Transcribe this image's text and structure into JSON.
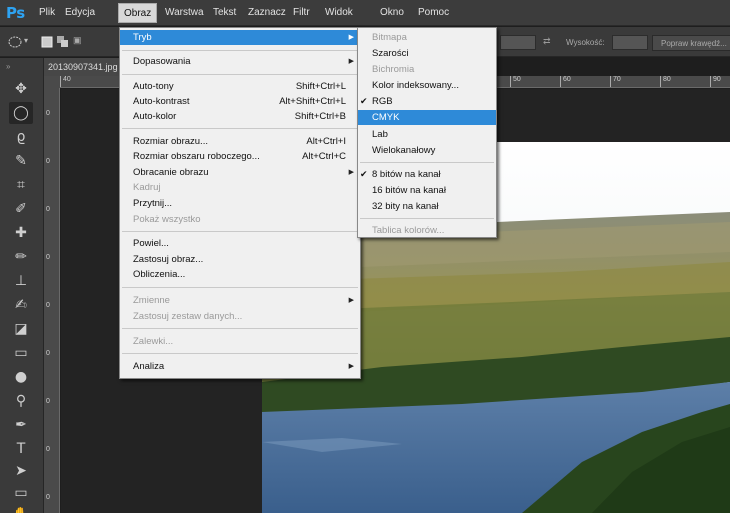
{
  "app": {
    "logo": "Ps"
  },
  "menubar": {
    "items": [
      "Plik",
      "Edycja",
      "Obraz",
      "Warstwa",
      "Tekst",
      "Zaznacz",
      "Filtr",
      "Widok",
      "Okno",
      "Pomoc"
    ],
    "active": "Obraz"
  },
  "options_bar": {
    "height_label": "Wysokość:",
    "refine_button": "Popraw krawędź..."
  },
  "document": {
    "tab_title": "20130907341.jpg",
    "ruler_top": [
      "40",
      "50",
      "60",
      "70",
      "80",
      "90"
    ],
    "ruler_left": [
      "0",
      "0",
      "0",
      "0",
      "0",
      "0",
      "0",
      "0",
      "0",
      "0",
      "0",
      "0",
      "0",
      "0",
      "0"
    ]
  },
  "obraz_menu": {
    "items": [
      {
        "label": "Tryb",
        "shortcut": "",
        "submenu": true,
        "highlighted": true,
        "disabled": false
      },
      {
        "label": "Dopasowania",
        "shortcut": "",
        "submenu": true,
        "highlighted": false,
        "disabled": false
      },
      {
        "label": "Auto-tony",
        "shortcut": "Shift+Ctrl+L",
        "submenu": false,
        "highlighted": false,
        "disabled": false
      },
      {
        "label": "Auto-kontrast",
        "shortcut": "Alt+Shift+Ctrl+L",
        "submenu": false,
        "highlighted": false,
        "disabled": false
      },
      {
        "label": "Auto-kolor",
        "shortcut": "Shift+Ctrl+B",
        "submenu": false,
        "highlighted": false,
        "disabled": false
      },
      {
        "label": "Rozmiar obrazu...",
        "shortcut": "Alt+Ctrl+I",
        "submenu": false,
        "highlighted": false,
        "disabled": false
      },
      {
        "label": "Rozmiar obszaru roboczego...",
        "shortcut": "Alt+Ctrl+C",
        "submenu": false,
        "highlighted": false,
        "disabled": false
      },
      {
        "label": "Obracanie obrazu",
        "shortcut": "",
        "submenu": true,
        "highlighted": false,
        "disabled": false
      },
      {
        "label": "Kadruj",
        "shortcut": "",
        "submenu": false,
        "highlighted": false,
        "disabled": true
      },
      {
        "label": "Przytnij...",
        "shortcut": "",
        "submenu": false,
        "highlighted": false,
        "disabled": false
      },
      {
        "label": "Pokaż wszystko",
        "shortcut": "",
        "submenu": false,
        "highlighted": false,
        "disabled": true
      },
      {
        "label": "Powiel...",
        "shortcut": "",
        "submenu": false,
        "highlighted": false,
        "disabled": false
      },
      {
        "label": "Zastosuj obraz...",
        "shortcut": "",
        "submenu": false,
        "highlighted": false,
        "disabled": false
      },
      {
        "label": "Obliczenia...",
        "shortcut": "",
        "submenu": false,
        "highlighted": false,
        "disabled": false
      },
      {
        "label": "Zmienne",
        "shortcut": "",
        "submenu": true,
        "highlighted": false,
        "disabled": true
      },
      {
        "label": "Zastosuj zestaw danych...",
        "shortcut": "",
        "submenu": false,
        "highlighted": false,
        "disabled": true
      },
      {
        "label": "Zalewki...",
        "shortcut": "",
        "submenu": false,
        "highlighted": false,
        "disabled": true
      },
      {
        "label": "Analiza",
        "shortcut": "",
        "submenu": true,
        "highlighted": false,
        "disabled": false
      }
    ]
  },
  "tryb_submenu": {
    "items": [
      {
        "label": "Bitmapa",
        "checked": false,
        "highlighted": false,
        "disabled": true
      },
      {
        "label": "Szarości",
        "checked": false,
        "highlighted": false,
        "disabled": false
      },
      {
        "label": "Bichromia",
        "checked": false,
        "highlighted": false,
        "disabled": true
      },
      {
        "label": "Kolor indeksowany...",
        "checked": false,
        "highlighted": false,
        "disabled": false
      },
      {
        "label": "RGB",
        "checked": true,
        "highlighted": false,
        "disabled": false
      },
      {
        "label": "CMYK",
        "checked": false,
        "highlighted": true,
        "disabled": false
      },
      {
        "label": "Lab",
        "checked": false,
        "highlighted": false,
        "disabled": false
      },
      {
        "label": "Wielokanałowy",
        "checked": false,
        "highlighted": false,
        "disabled": false
      },
      {
        "label": "8 bitów na kanał",
        "checked": true,
        "highlighted": false,
        "disabled": false
      },
      {
        "label": "16 bitów na kanał",
        "checked": false,
        "highlighted": false,
        "disabled": false
      },
      {
        "label": "32 bity na kanał",
        "checked": false,
        "highlighted": false,
        "disabled": false
      },
      {
        "label": "Tablica kolorów...",
        "checked": false,
        "highlighted": false,
        "disabled": true
      }
    ]
  },
  "glyphs": {
    "submenu_arrow": "▶",
    "check": "✔",
    "tools_grip": "»"
  },
  "colors": {
    "highlight": "#2e8ad8",
    "ps_logo": "#2ea3f2",
    "menu_bg": "#f0f0f0"
  }
}
